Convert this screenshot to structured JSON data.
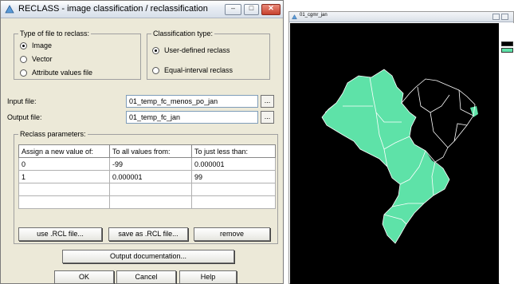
{
  "dialog": {
    "title": "RECLASS - image classification / reclassification",
    "buttons": {
      "minimize": "–",
      "maximize": "□",
      "close": "✕"
    },
    "file_type": {
      "legend": "Type of file to reclass:",
      "options": [
        "Image",
        "Vector",
        "Attribute values file"
      ],
      "selected": "Image"
    },
    "classification_type": {
      "legend": "Classification type:",
      "options": [
        "User-defined reclass",
        "Equal-interval reclass"
      ],
      "selected": "User-defined reclass"
    },
    "input_file": {
      "label": "Input file:",
      "value": "01_temp_fc_menos_po_jan",
      "browse": "..."
    },
    "output_file": {
      "label": "Output file:",
      "value": "01_temp_fc_jan",
      "browse": "..."
    },
    "reclass_params": {
      "legend": "Reclass parameters:",
      "columns": [
        "Assign a new value of:",
        "To all values from:",
        "To just less than:"
      ],
      "rows": [
        [
          "0",
          "-99",
          "0.000001"
        ],
        [
          "1",
          "0.000001",
          "99"
        ],
        [
          "",
          "",
          ""
        ]
      ],
      "buttons": {
        "use_rcl": "use .RCL file...",
        "save_rcl": "save as .RCL file...",
        "remove": "remove"
      }
    },
    "output_doc_button": "Output documentation...",
    "ok_button": "OK",
    "cancel_button": "Cancel",
    "help_button": "Help"
  },
  "map_window": {
    "title": "01_cgmr_jan",
    "legend_colors": [
      "#000000",
      "#5ee2a8"
    ],
    "map_colors": {
      "background": "#000000",
      "class_1": "#5ee2a8",
      "class_0": "#000000",
      "boundary": "#ffffff"
    }
  },
  "colors": {
    "dialog_bg": "#ece9d8",
    "icon_accent": "#5a9bd8"
  }
}
